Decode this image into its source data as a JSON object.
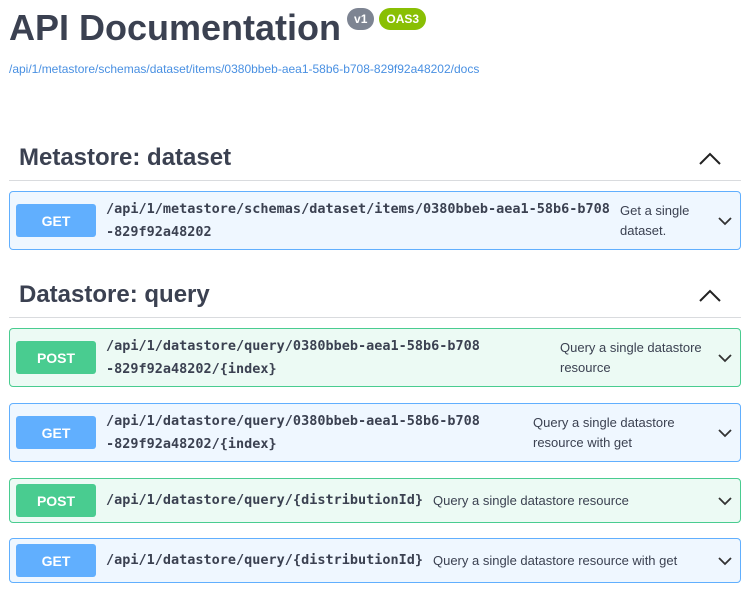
{
  "header": {
    "title": "API Documentation",
    "version_badge": "v1",
    "spec_badge": "OAS3",
    "url": "/api/1/metastore/schemas/dataset/items/0380bbeb-aea1-58b6-b708-829f92a48202/docs"
  },
  "sections": [
    {
      "title": "Metastore: dataset",
      "operations": [
        {
          "method": "GET",
          "path": "/api/1/metastore/schemas/dataset/items/0380bbeb-aea1-58b6-b708-829f92a48202",
          "summary": "Get a single dataset."
        }
      ]
    },
    {
      "title": "Datastore: query",
      "operations": [
        {
          "method": "POST",
          "path": "/api/1/datastore/query/0380bbeb-aea1-58b6-b708-829f92a48202/{index}",
          "summary": "Query a single datastore resource"
        },
        {
          "method": "GET",
          "path": "/api/1/datastore/query/0380bbeb-aea1-58b6-b708-829f92a48202/{index}",
          "summary": "Query a single datastore resource with get"
        },
        {
          "method": "POST",
          "path": "/api/1/datastore/query/{distributionId}",
          "summary": "Query a single datastore resource"
        },
        {
          "method": "GET",
          "path": "/api/1/datastore/query/{distributionId}",
          "summary": "Query a single datastore resource with get"
        }
      ]
    }
  ],
  "colors": {
    "get": "#61affe",
    "post": "#49cc90",
    "version_badge": "#7d8492",
    "spec_badge": "#89bf04",
    "link": "#4990e2"
  }
}
